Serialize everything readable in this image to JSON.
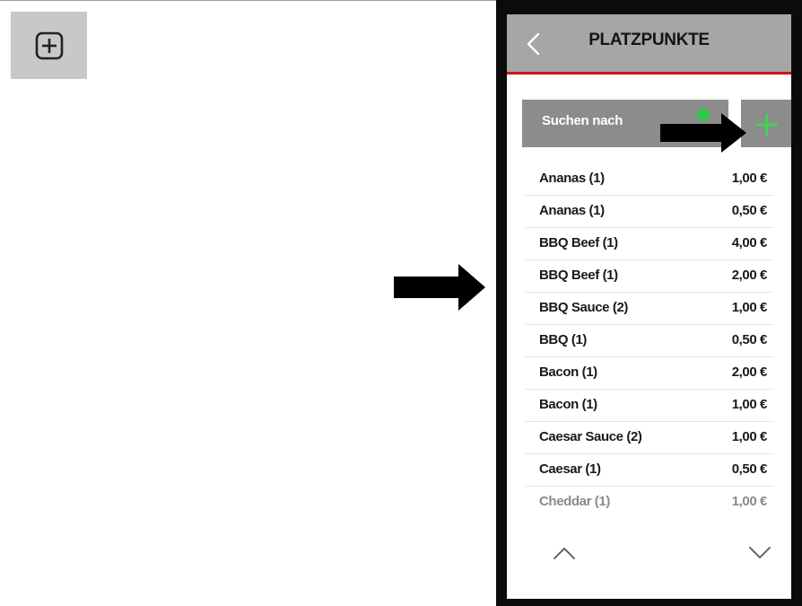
{
  "screen": {
    "title": "PLATZPUNKTE",
    "search_label": "Suchen nach",
    "accent_color": "#c8161d",
    "add_color": "#31e04a"
  },
  "items": [
    {
      "name": "Ananas (1)",
      "price": "1,00 €"
    },
    {
      "name": "Ananas (1)",
      "price": "0,50 €"
    },
    {
      "name": "BBQ Beef (1)",
      "price": "4,00 €"
    },
    {
      "name": "BBQ Beef (1)",
      "price": "2,00 €"
    },
    {
      "name": "BBQ Sauce (2)",
      "price": "1,00 €"
    },
    {
      "name": "BBQ (1)",
      "price": "0,50 €"
    },
    {
      "name": "Bacon (1)",
      "price": "2,00 €"
    },
    {
      "name": "Bacon (1)",
      "price": "1,00 €"
    },
    {
      "name": "Caesar Sauce (2)",
      "price": "1,00 €"
    },
    {
      "name": "Caesar (1)",
      "price": "0,50 €"
    },
    {
      "name": "Cheddar (1)",
      "price": "1,00 €"
    }
  ],
  "icons": {
    "toolbar": "plus-square-icon",
    "back": "chevron-left-icon",
    "add": "plus-icon",
    "up": "chevron-up-icon",
    "down": "chevron-down-icon",
    "pointer": "arrow-right-icon"
  }
}
